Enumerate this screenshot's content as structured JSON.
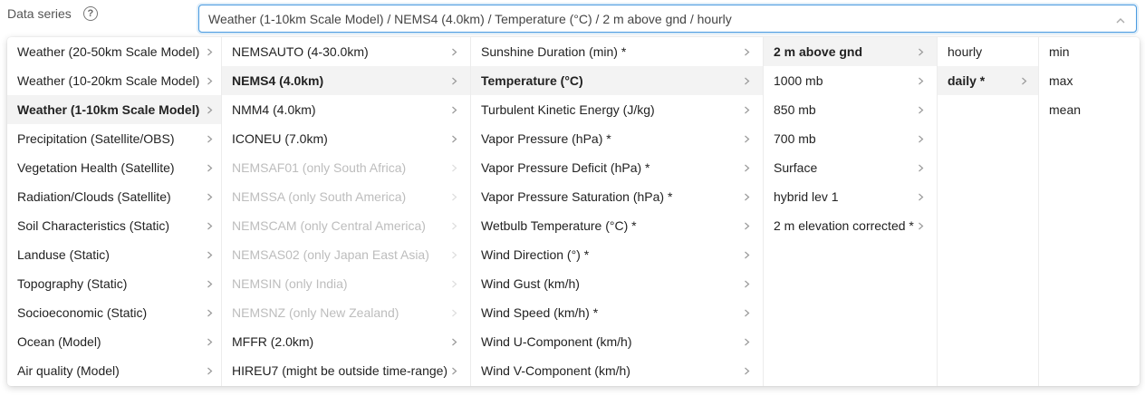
{
  "field": {
    "label": "Data series",
    "help_icon": "question-circle-icon",
    "selected_value": "Weather (1-10km Scale Model) / NEMS4 (4.0km) / Temperature (°C) / 2 m above gnd / hourly",
    "chevron_icon": "chevron-up-icon",
    "accent_color": "#4a9be0"
  },
  "columns": [
    {
      "items": [
        {
          "label": "Weather (20-50km Scale Model)",
          "has_arrow": true,
          "active": false,
          "disabled": false
        },
        {
          "label": "Weather (10-20km Scale Model)",
          "has_arrow": true,
          "active": false,
          "disabled": false
        },
        {
          "label": "Weather (1-10km Scale Model)",
          "has_arrow": true,
          "active": true,
          "disabled": false
        },
        {
          "label": "Precipitation (Satellite/OBS)",
          "has_arrow": true,
          "active": false,
          "disabled": false
        },
        {
          "label": "Vegetation Health (Satellite)",
          "has_arrow": true,
          "active": false,
          "disabled": false
        },
        {
          "label": "Radiation/Clouds (Satellite)",
          "has_arrow": true,
          "active": false,
          "disabled": false
        },
        {
          "label": "Soil Characteristics (Static)",
          "has_arrow": true,
          "active": false,
          "disabled": false
        },
        {
          "label": "Landuse (Static)",
          "has_arrow": true,
          "active": false,
          "disabled": false
        },
        {
          "label": "Topography (Static)",
          "has_arrow": true,
          "active": false,
          "disabled": false
        },
        {
          "label": "Socioeconomic (Static)",
          "has_arrow": true,
          "active": false,
          "disabled": false
        },
        {
          "label": "Ocean (Model)",
          "has_arrow": true,
          "active": false,
          "disabled": false
        },
        {
          "label": "Air quality (Model)",
          "has_arrow": true,
          "active": false,
          "disabled": false
        }
      ]
    },
    {
      "items": [
        {
          "label": "NEMSAUTO (4-30.0km)",
          "has_arrow": true,
          "active": false,
          "disabled": false
        },
        {
          "label": "NEMS4 (4.0km)",
          "has_arrow": true,
          "active": true,
          "disabled": false
        },
        {
          "label": "NMM4 (4.0km)",
          "has_arrow": true,
          "active": false,
          "disabled": false
        },
        {
          "label": "ICONEU (7.0km)",
          "has_arrow": true,
          "active": false,
          "disabled": false
        },
        {
          "label": "NEMSAF01 (only South Africa)",
          "has_arrow": false,
          "active": false,
          "disabled": true
        },
        {
          "label": "NEMSSA (only South America)",
          "has_arrow": false,
          "active": false,
          "disabled": true
        },
        {
          "label": "NEMSCAM (only Central America)",
          "has_arrow": false,
          "active": false,
          "disabled": true
        },
        {
          "label": "NEMSAS02 (only Japan East Asia)",
          "has_arrow": false,
          "active": false,
          "disabled": true
        },
        {
          "label": "NEMSIN (only India)",
          "has_arrow": false,
          "active": false,
          "disabled": true
        },
        {
          "label": "NEMSNZ (only New Zealand)",
          "has_arrow": false,
          "active": false,
          "disabled": true
        },
        {
          "label": "MFFR (2.0km)",
          "has_arrow": true,
          "active": false,
          "disabled": false
        },
        {
          "label": "HIREU7 (might be outside time-range)",
          "has_arrow": true,
          "active": false,
          "disabled": false
        }
      ]
    },
    {
      "items": [
        {
          "label": "Sunshine Duration (min) *",
          "has_arrow": true,
          "active": false,
          "disabled": false
        },
        {
          "label": "Temperature (°C)",
          "has_arrow": true,
          "active": true,
          "disabled": false
        },
        {
          "label": "Turbulent Kinetic Energy (J/kg)",
          "has_arrow": true,
          "active": false,
          "disabled": false
        },
        {
          "label": "Vapor Pressure (hPa) *",
          "has_arrow": true,
          "active": false,
          "disabled": false
        },
        {
          "label": "Vapor Pressure Deficit (hPa) *",
          "has_arrow": true,
          "active": false,
          "disabled": false
        },
        {
          "label": "Vapor Pressure Saturation (hPa) *",
          "has_arrow": true,
          "active": false,
          "disabled": false
        },
        {
          "label": "Wetbulb Temperature (°C) *",
          "has_arrow": true,
          "active": false,
          "disabled": false
        },
        {
          "label": "Wind Direction (°) *",
          "has_arrow": true,
          "active": false,
          "disabled": false
        },
        {
          "label": "Wind Gust (km/h)",
          "has_arrow": true,
          "active": false,
          "disabled": false
        },
        {
          "label": "Wind Speed (km/h) *",
          "has_arrow": true,
          "active": false,
          "disabled": false
        },
        {
          "label": "Wind U-Component (km/h)",
          "has_arrow": true,
          "active": false,
          "disabled": false
        },
        {
          "label": "Wind V-Component (km/h)",
          "has_arrow": true,
          "active": false,
          "disabled": false
        }
      ]
    },
    {
      "items": [
        {
          "label": "2 m above gnd",
          "has_arrow": true,
          "active": true,
          "disabled": false
        },
        {
          "label": "1000 mb",
          "has_arrow": true,
          "active": false,
          "disabled": false
        },
        {
          "label": "850 mb",
          "has_arrow": true,
          "active": false,
          "disabled": false
        },
        {
          "label": "700 mb",
          "has_arrow": true,
          "active": false,
          "disabled": false
        },
        {
          "label": "Surface",
          "has_arrow": true,
          "active": false,
          "disabled": false
        },
        {
          "label": "hybrid lev 1",
          "has_arrow": true,
          "active": false,
          "disabled": false
        },
        {
          "label": "2 m elevation corrected *",
          "has_arrow": true,
          "active": false,
          "disabled": false
        }
      ]
    },
    {
      "items": [
        {
          "label": "hourly",
          "has_arrow": false,
          "active": false,
          "disabled": false
        },
        {
          "label": "daily *",
          "has_arrow": true,
          "active": true,
          "disabled": false
        }
      ]
    },
    {
      "items": [
        {
          "label": "min",
          "has_arrow": false,
          "active": false,
          "disabled": false
        },
        {
          "label": "max",
          "has_arrow": false,
          "active": false,
          "disabled": false
        },
        {
          "label": "mean",
          "has_arrow": false,
          "active": false,
          "disabled": false
        }
      ]
    }
  ]
}
